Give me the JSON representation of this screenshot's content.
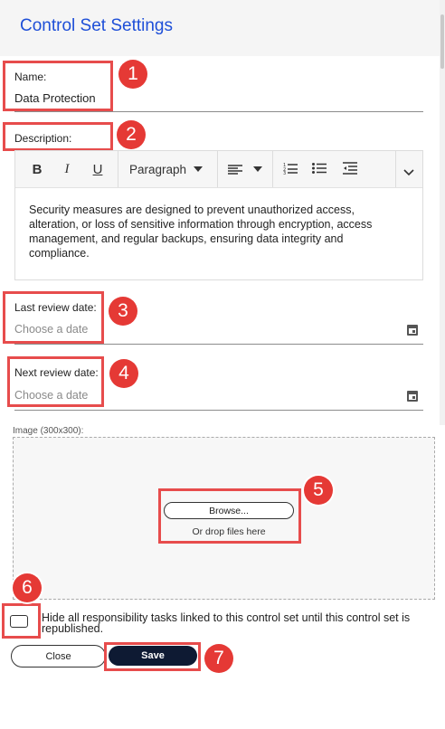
{
  "header": {
    "title": "Control Set Settings"
  },
  "name_field": {
    "label": "Name:",
    "value": "Data Protection"
  },
  "description": {
    "label": "Description:",
    "toolbar": {
      "bold": "B",
      "italic": "I",
      "underline": "U",
      "paragraph": "Paragraph"
    },
    "text": "Security measures are designed to prevent unauthorized access, alteration, or loss of sensitive information through encryption, access management, and regular backups, ensuring data integrity and compliance."
  },
  "last_review": {
    "label": "Last review date:",
    "placeholder": "Choose a date"
  },
  "next_review": {
    "label": "Next review date:",
    "placeholder": "Choose a date"
  },
  "image": {
    "label": "Image (300x300):",
    "browse_label": "Browse...",
    "drop_hint": "Or drop files here"
  },
  "hide_tasks": {
    "label": "Hide all responsibility tasks linked to this control set until this control set is republished.",
    "checked": false
  },
  "actions": {
    "close_label": "Close",
    "save_label": "Save"
  },
  "annotations": [
    "1",
    "2",
    "3",
    "4",
    "5",
    "6",
    "7"
  ],
  "colors": {
    "title": "#1e4fd8",
    "highlight": "#e74c4c",
    "badge": "#e53935",
    "save_bg": "#0e1a33"
  }
}
